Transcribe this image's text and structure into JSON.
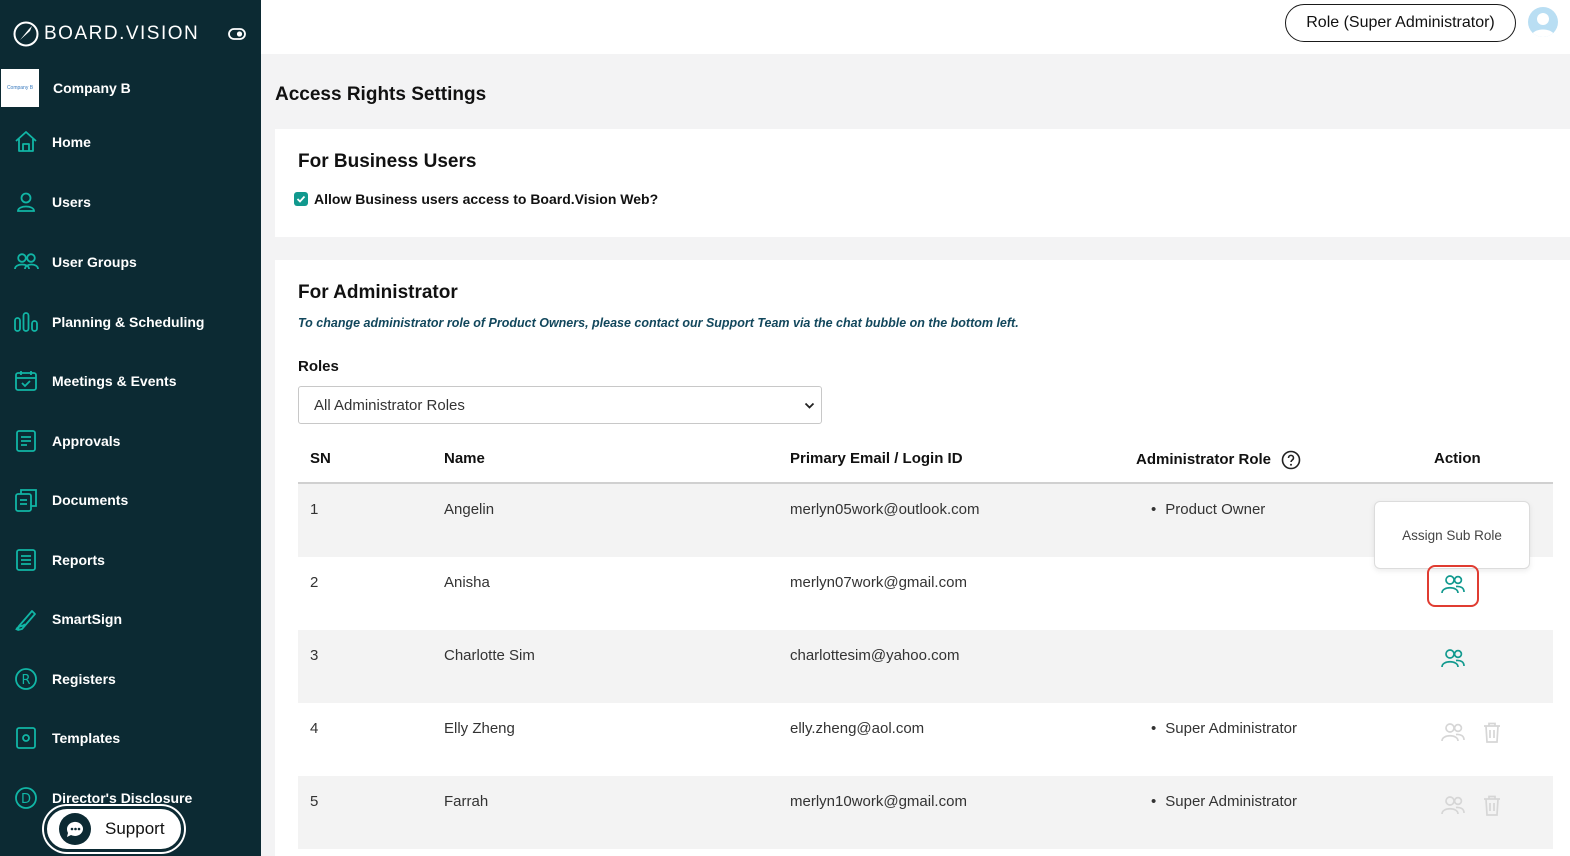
{
  "app": {
    "brand_text": "BOARD.VISION",
    "company_name": "Company B",
    "company_logo_text": "Company B"
  },
  "sidebar": {
    "items": [
      {
        "label": "Home",
        "icon": "home-icon"
      },
      {
        "label": "Users",
        "icon": "user-icon"
      },
      {
        "label": "User Groups",
        "icon": "user-groups-icon"
      },
      {
        "label": "Planning & Scheduling",
        "icon": "planning-icon"
      },
      {
        "label": "Meetings & Events",
        "icon": "calendar-icon"
      },
      {
        "label": "Approvals",
        "icon": "approvals-icon"
      },
      {
        "label": "Documents",
        "icon": "documents-icon"
      },
      {
        "label": "Reports",
        "icon": "reports-icon"
      },
      {
        "label": "SmartSign",
        "icon": "pen-icon"
      },
      {
        "label": "Registers",
        "icon": "registered-icon"
      },
      {
        "label": "Templates",
        "icon": "templates-icon"
      },
      {
        "label": "Director's Disclosure",
        "icon": "disclosure-icon"
      }
    ],
    "support_label": "Support"
  },
  "header": {
    "role_label": "Role (Super Administrator)"
  },
  "page": {
    "title": "Access Rights Settings",
    "business": {
      "heading": "For Business Users",
      "checkbox_label": "Allow Business users access to Board.Vision Web?",
      "checked": true
    },
    "admin": {
      "heading": "For Administrator",
      "note": "To change administrator role of Product Owners, please contact our Support Team via the chat bubble on the bottom left.",
      "roles_label": "Roles",
      "roles_selected": "All Administrator Roles"
    }
  },
  "table": {
    "headers": {
      "sn": "SN",
      "name": "Name",
      "email": "Primary Email / Login ID",
      "role": "Administrator Role",
      "action": "Action"
    },
    "rows": [
      {
        "sn": "1",
        "name": "Angelin",
        "email": "merlyn05work@outlook.com",
        "role": "Product Owner"
      },
      {
        "sn": "2",
        "name": "Anisha",
        "email": "merlyn07work@gmail.com",
        "role": ""
      },
      {
        "sn": "3",
        "name": "Charlotte Sim",
        "email": "charlottesim@yahoo.com",
        "role": ""
      },
      {
        "sn": "4",
        "name": "Elly Zheng",
        "email": "elly.zheng@aol.com",
        "role": "Super Administrator"
      },
      {
        "sn": "5",
        "name": "Farrah",
        "email": "merlyn10work@gmail.com",
        "role": "Super Administrator"
      }
    ],
    "tooltip": "Assign Sub Role"
  },
  "colors": {
    "sidebar_bg": "#0c2a33",
    "accent_teal": "#11998e",
    "highlight_red": "#e03c31"
  }
}
